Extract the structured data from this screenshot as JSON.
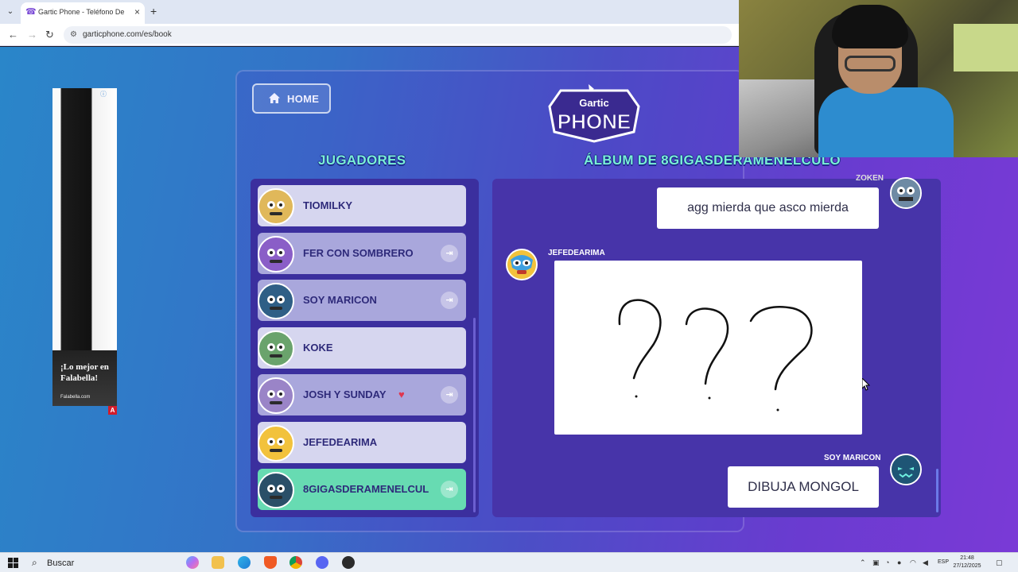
{
  "browser": {
    "tab_title": "Gartic Phone - Teléfono Descompuesto",
    "url": "garticphone.com/es/book"
  },
  "ad": {
    "headline": "¡Lo mejor en Falabella!",
    "source": "Falabella.com"
  },
  "game": {
    "home_label": "HOME",
    "logo_top": "Gartic",
    "logo_bottom": "PHONE",
    "players_title": "JUGADORES",
    "album_title": "ÁLBUM DE 8GIGASDERAMENELCULO",
    "players": [
      {
        "name": "TIOMILKY",
        "state": "normal",
        "has_badge": false
      },
      {
        "name": "FER CON SOMBRERO",
        "state": "dim",
        "has_badge": true
      },
      {
        "name": "SOY MARICON",
        "state": "dim",
        "has_badge": true
      },
      {
        "name": "KOKE",
        "state": "normal",
        "has_badge": false
      },
      {
        "name": "JOSH Y SUNDAY",
        "state": "dim",
        "has_badge": true
      },
      {
        "name": "JEFEDEARIMA",
        "state": "normal",
        "has_badge": false
      },
      {
        "name": "8GIGASDERAMENELCUL",
        "state": "self",
        "has_badge": true
      }
    ],
    "heart": "♥",
    "album": {
      "top_author": "ZOKEN",
      "top_message": "agg mierda que asco mierda",
      "drawing_author": "JEFEDEARIMA",
      "drawing_content": "???",
      "bottom_author": "SOY MARICON",
      "bottom_message": "DIBUJA MONGOL"
    }
  },
  "taskbar": {
    "search_label": "Buscar",
    "lang": "ESP",
    "time": "21:48",
    "date": "27/12/2025"
  }
}
